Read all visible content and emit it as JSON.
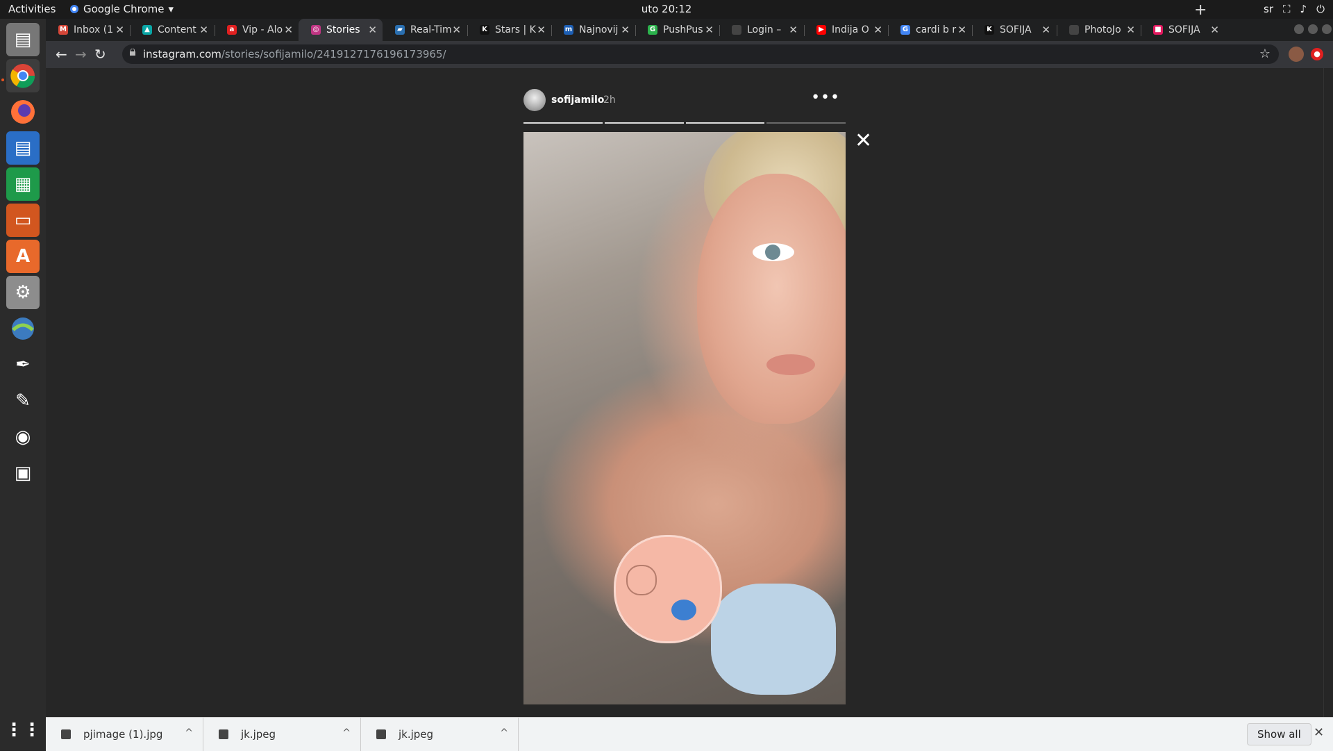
{
  "topbar": {
    "activities": "Activities",
    "app_name": "Google Chrome",
    "clock": "uto 20:12",
    "lang": "sr"
  },
  "dock": {
    "items": [
      "files",
      "chrome",
      "firefox",
      "writer",
      "calc",
      "impress",
      "software",
      "tweaks",
      "network",
      "inkscape",
      "text-editor",
      "screenshot",
      "image-viewer"
    ]
  },
  "tabs": [
    {
      "title": "Inbox (1",
      "color": "#d44638",
      "glyph": "M"
    },
    {
      "title": "Content",
      "color": "#0aa6a6",
      "glyph": "▲"
    },
    {
      "title": "Vip - Alo",
      "color": "#e02020",
      "glyph": "a"
    },
    {
      "title": "Stories",
      "color": "#c13584",
      "glyph": "◎",
      "active": true
    },
    {
      "title": "Real-Tim",
      "color": "#2a6fb0",
      "glyph": "▰"
    },
    {
      "title": "Stars | K",
      "color": "#111",
      "glyph": "K"
    },
    {
      "title": "Najnovij",
      "color": "#1d5fb4",
      "glyph": "m"
    },
    {
      "title": "PushPus",
      "color": "#2bb24c",
      "glyph": "G"
    },
    {
      "title": "Login –",
      "color": "#444",
      "glyph": ""
    },
    {
      "title": "Indija O",
      "color": "#ff0000",
      "glyph": "▶"
    },
    {
      "title": "cardi b r",
      "color": "#4285f4",
      "glyph": "G"
    },
    {
      "title": "SOFIJA",
      "color": "#111",
      "glyph": "K"
    },
    {
      "title": "PhotoJo",
      "color": "#444",
      "glyph": ""
    },
    {
      "title": "SOFIJA",
      "color": "#e2195f",
      "glyph": "■"
    }
  ],
  "address": {
    "host": "instagram.com",
    "path": "/stories/sofijamilo/2419127176196173965/"
  },
  "story": {
    "username": "sofijamilo",
    "time": "2h",
    "more": "•••",
    "close": "✕",
    "segments_total": 4,
    "segments_done": 3
  },
  "downloads": [
    {
      "name": "pjimage (1).jpg"
    },
    {
      "name": "jk.jpeg"
    },
    {
      "name": "jk.jpeg"
    }
  ],
  "show_all": "Show all"
}
